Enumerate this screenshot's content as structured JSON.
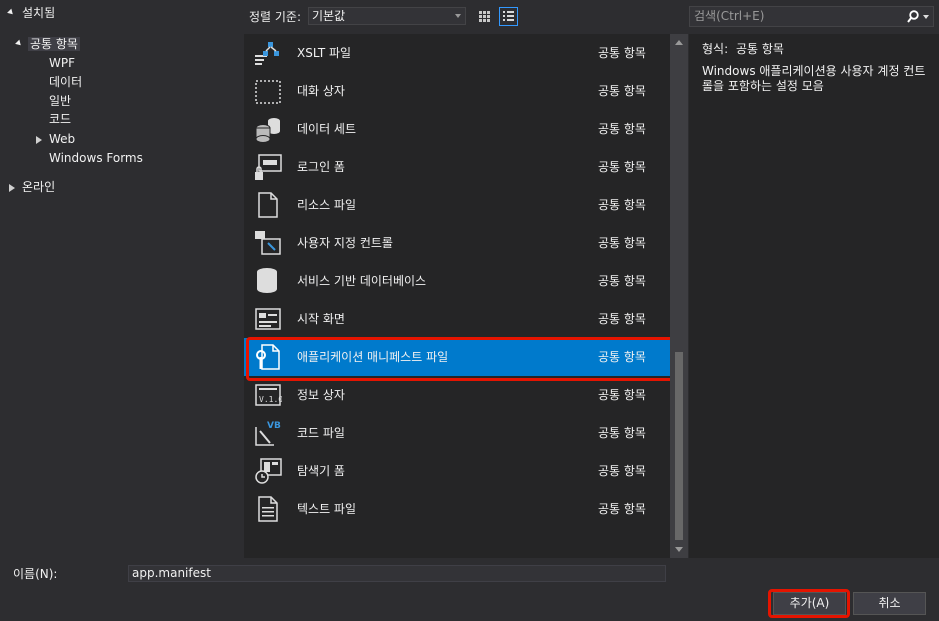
{
  "tree": {
    "installed": "설치됨",
    "common": "공통 항목",
    "children": [
      "WPF",
      "데이터",
      "일반",
      "코드",
      "Web",
      "Windows Forms"
    ],
    "online": "온라인"
  },
  "toolbar": {
    "sort_label": "정렬 기준:",
    "sort_value": "기본값"
  },
  "items": [
    {
      "name": "XSLT 파일",
      "category": "공통 항목",
      "icon": "xslt-file-icon"
    },
    {
      "name": "대화 상자",
      "category": "공통 항목",
      "icon": "dialog-icon"
    },
    {
      "name": "데이터 세트",
      "category": "공통 항목",
      "icon": "dataset-icon"
    },
    {
      "name": "로그인 폼",
      "category": "공통 항목",
      "icon": "login-form-icon"
    },
    {
      "name": "리소스 파일",
      "category": "공통 항목",
      "icon": "resource-file-icon"
    },
    {
      "name": "사용자 지정 컨트롤",
      "category": "공통 항목",
      "icon": "custom-control-icon"
    },
    {
      "name": "서비스 기반 데이터베이스",
      "category": "공통 항목",
      "icon": "database-icon"
    },
    {
      "name": "시작 화면",
      "category": "공통 항목",
      "icon": "splash-screen-icon"
    },
    {
      "name": "애플리케이션 매니페스트 파일",
      "category": "공통 항목",
      "icon": "manifest-file-icon"
    },
    {
      "name": "정보 상자",
      "category": "공통 항목",
      "icon": "about-box-icon"
    },
    {
      "name": "코드 파일",
      "category": "공통 항목",
      "icon": "code-file-icon"
    },
    {
      "name": "탐색기 폼",
      "category": "공통 항목",
      "icon": "explorer-form-icon"
    },
    {
      "name": "텍스트 파일",
      "category": "공통 항목",
      "icon": "text-file-icon"
    }
  ],
  "search": {
    "placeholder": "검색(Ctrl+E)"
  },
  "detail": {
    "type_label": "형식:",
    "type_value": "공통 항목",
    "description": "Windows 애플리케이션용 사용자 계정 컨트롤을 포함하는 설정 모음"
  },
  "footer": {
    "name_label": "이름(N):",
    "name_value": "app.manifest",
    "add_label": "추가(A)",
    "cancel_label": "취소"
  },
  "colors": {
    "selection": "#007acc",
    "highlight": "#e51400",
    "background": "#2d2d30"
  }
}
